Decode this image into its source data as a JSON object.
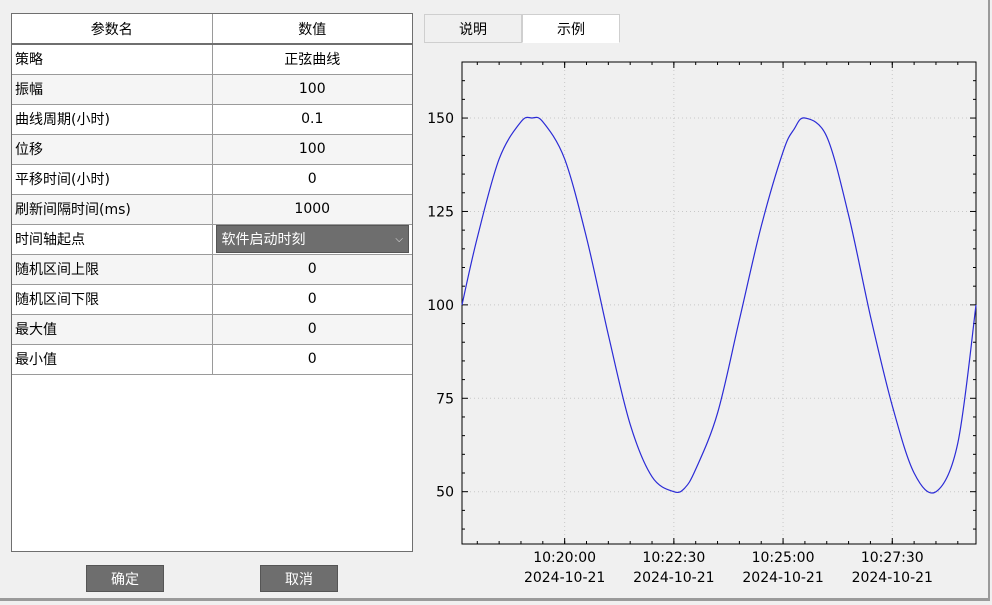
{
  "table": {
    "header": {
      "name": "参数名",
      "value": "数值"
    },
    "rows": [
      {
        "name": "策略",
        "value": "正弦曲线"
      },
      {
        "name": "振幅",
        "value": "100"
      },
      {
        "name": "曲线周期(小时)",
        "value": "0.1"
      },
      {
        "name": "位移",
        "value": "100"
      },
      {
        "name": "平移时间(小时)",
        "value": "0"
      },
      {
        "name": "刷新间隔时间(ms)",
        "value": "1000"
      },
      {
        "name": "时间轴起点",
        "value": "软件启动时刻"
      },
      {
        "name": "随机区间上限",
        "value": "0"
      },
      {
        "name": "随机区间下限",
        "value": "0"
      },
      {
        "name": "最大值",
        "value": "0"
      },
      {
        "name": "最小值",
        "value": "0"
      }
    ]
  },
  "buttons": {
    "ok": "确定",
    "cancel": "取消"
  },
  "tabs": [
    {
      "label": "说明",
      "active": false
    },
    {
      "label": "示例",
      "active": true
    }
  ],
  "chart_data": {
    "type": "line",
    "title": "",
    "xlabel": "",
    "ylabel": "",
    "ylim": [
      36,
      165
    ],
    "xlim": [
      "2024-10-21 10:17:39",
      "2024-10-21 10:29:25"
    ],
    "yticks": [
      50,
      75,
      100,
      125,
      150
    ],
    "xticks": [
      {
        "time": "10:20:00",
        "date": "2024-10-21"
      },
      {
        "time": "10:22:30",
        "date": "2024-10-21"
      },
      {
        "time": "10:25:00",
        "date": "2024-10-21"
      },
      {
        "time": "10:27:30",
        "date": "2024-10-21"
      }
    ],
    "grid": true,
    "line_color": "#2b2bd6",
    "series": [
      {
        "x": [
          "10:17:39",
          "10:18:00",
          "10:18:30",
          "10:19:00",
          "10:19:15",
          "10:19:30",
          "10:20:00",
          "10:20:30",
          "10:21:00",
          "10:21:30",
          "10:22:00",
          "10:22:30",
          "10:22:45",
          "10:23:00",
          "10:23:30",
          "10:24:00",
          "10:24:30",
          "10:25:00",
          "10:25:15",
          "10:25:30",
          "10:26:00",
          "10:26:30",
          "10:27:00",
          "10:27:30",
          "10:28:00",
          "10:28:30",
          "10:29:00",
          "10:29:25"
        ],
        "y": [
          100,
          118,
          139,
          149,
          150,
          149,
          139,
          118,
          92,
          68,
          54,
          50,
          51,
          56,
          71,
          96,
          121,
          141,
          147,
          150,
          145,
          124,
          97,
          73,
          55,
          50,
          63,
          100
        ]
      }
    ]
  }
}
